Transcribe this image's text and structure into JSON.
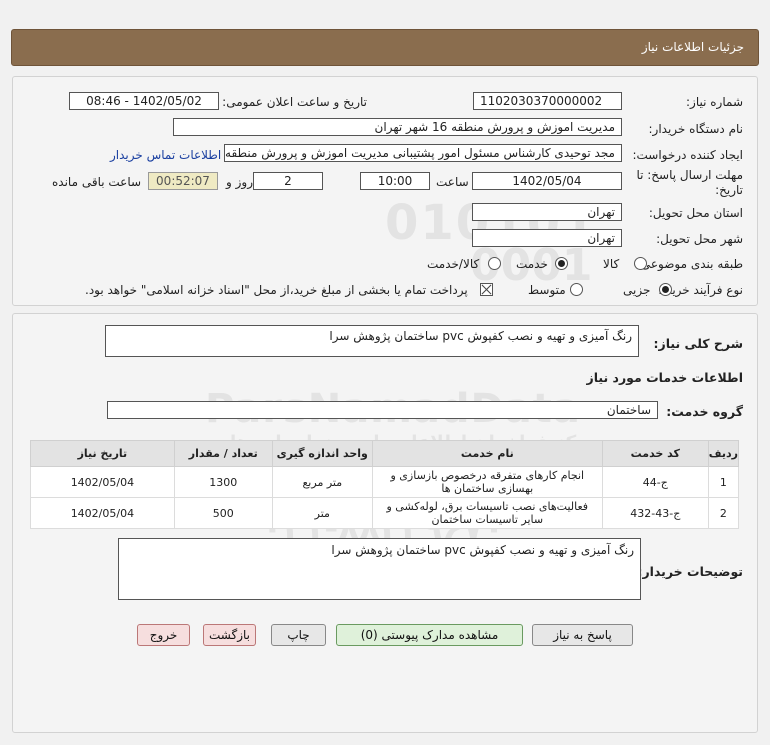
{
  "header": {
    "title": "جزئیات اطلاعات نیاز"
  },
  "info": {
    "need_number_label": "شماره نیاز:",
    "need_number": "1102030370000002",
    "announce_label": "تاریخ و ساعت اعلان عمومی:",
    "announce_value": "1402/05/02 - 08:46",
    "buyer_org_label": "نام دستگاه خریدار:",
    "buyer_org": "مدیریت اموزش و پرورش منطقه 16 شهر تهران",
    "creator_label": "ایجاد کننده درخواست:",
    "creator": "مجد توحیدی کارشناس مسئول امور پشتیبانی مدیریت اموزش و پرورش منطقه 6",
    "contact_link": "اطلاعات تماس خریدار",
    "deadline_label": "مهلت ارسال پاسخ: تا تاریخ:",
    "deadline_date": "1402/05/04",
    "hour_label": "ساعت",
    "deadline_hour": "10:00",
    "days_value": "2",
    "days_label": "روز و",
    "remaining_time": "00:52:07",
    "remaining_label": "ساعت باقی مانده",
    "province_label": "استان محل تحویل:",
    "province": "تهران",
    "city_label": "شهر محل تحویل:",
    "city": "تهران",
    "category_label": "طبقه بندی موضوعی:",
    "category_options": [
      "کالا",
      "خدمت",
      "کالا/خدمت"
    ],
    "category_selected": "خدمت",
    "purchase_type_label": "نوع فرآیند خرید :",
    "purchase_options": [
      "جزیی",
      "متوسط"
    ],
    "purchase_selected": "جزیی",
    "payment_note": "پرداخت تمام یا بخشی از مبلغ خرید،از محل \"اسناد خزانه اسلامی\" خواهد بود."
  },
  "details": {
    "summary_label": "شرح کلی نیاز:",
    "summary": "رنگ آمیزی و تهیه و نصب کفپوش pvc ساختمان پژوهش سرا",
    "services_heading": "اطلاعات خدمات مورد نیاز",
    "service_group_label": "گروه خدمت:",
    "service_group": "ساختمان",
    "table": {
      "headers": [
        "ردیف",
        "کد خدمت",
        "نام خدمت",
        "واحد اندازه گیری",
        "تعداد / مقدار",
        "تاریخ نیاز"
      ],
      "rows": [
        [
          "1",
          "ج-44",
          "انجام کارهای متفرقه درخصوص بازسازی و بهسازی ساختمان ها",
          "متر مربع",
          "1300",
          "1402/05/04"
        ],
        [
          "2",
          "ج-43-432",
          "فعالیت‌های نصب تاسیسات برق، لوله‌کشی و سایر تاسیسات ساختمان",
          "متر",
          "500",
          "1402/05/04"
        ]
      ]
    },
    "buyer_notes_label": "توضیحات خریدار:",
    "buyer_notes": "رنگ آمیزی و تهیه و نصب کفپوش pvc ساختمان پژوهش سرا"
  },
  "buttons": {
    "reply": "پاسخ به نیاز",
    "attachments": "مشاهده مدارک پیوستی (0)",
    "print": "چاپ",
    "back": "بازگشت",
    "exit": "خروج"
  },
  "watermark": {
    "digits1": "010101",
    "digits2": "0001",
    "brand": "ParsNamadData",
    "line1": "مرکز فراخوان اطلاعات پارس نماد داده ها",
    "line2": "پایگاه اطلاع رسانی مناقصه و مزایده",
    "phone": "۰۲۱-۸۸۳۴۹۶۷۰"
  }
}
